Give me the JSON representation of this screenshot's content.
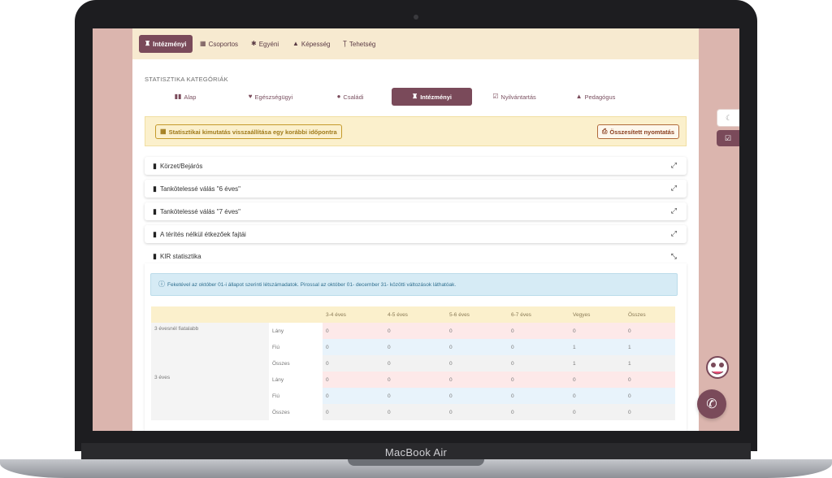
{
  "device": {
    "brand": "MacBook Air"
  },
  "topnav": {
    "tabs": [
      {
        "label": "Intézményi",
        "icon": "institution-icon",
        "active": true
      },
      {
        "label": "Csoportos",
        "icon": "grid-icon"
      },
      {
        "label": "Egyéni",
        "icon": "gear-icon"
      },
      {
        "label": "Képesség",
        "icon": "graduation-cap-icon"
      },
      {
        "label": "Tehetség",
        "icon": "trophy-icon"
      }
    ]
  },
  "section_title": "STATISZTIKA KATEGÓRIÁK",
  "categories": [
    {
      "label": "Alap",
      "icon": "columns-icon"
    },
    {
      "label": "Egészségügyi",
      "icon": "heart-icon"
    },
    {
      "label": "Családi",
      "icon": "user-icon"
    },
    {
      "label": "Intézményi",
      "icon": "institution-icon",
      "active": true
    },
    {
      "label": "Nyilvántartás",
      "icon": "check-square-icon"
    },
    {
      "label": "Pedagógus",
      "icon": "graduation-cap-icon"
    }
  ],
  "alert": {
    "restore_label": "Statisztikai kimutatás visszaállítása egy korábbi időpontra",
    "print_label": "Összesített nyomtatás"
  },
  "accordions": [
    {
      "label": "Körzet/Bejárós"
    },
    {
      "label": "Tankötelessé válás \"6 éves\""
    },
    {
      "label": "Tankötelessé válás \"7 éves\""
    },
    {
      "label": "A térítés nélkül étkezőek fajtái"
    },
    {
      "label": "KIR statisztika"
    }
  ],
  "kir": {
    "info": "Feketével az október 01-i állapot szerinti létszámadatok. Pirossal az október 01- december 31- közötti változások láthatóak.",
    "headers": [
      "3-4 éves",
      "4-5 éves",
      "5-6 éves",
      "6-7 éves",
      "Vegyes",
      "Összes"
    ],
    "groups": [
      {
        "label": "3 évesnél fiatalabb",
        "rows": [
          {
            "label": "Lány",
            "values": [
              "0",
              "0",
              "0",
              "0",
              "0",
              "0"
            ]
          },
          {
            "label": "Fiú",
            "values": [
              "0",
              "0",
              "0",
              "0",
              "1",
              "1"
            ]
          },
          {
            "label": "Összes",
            "values": [
              "0",
              "0",
              "0",
              "0",
              "1",
              "1"
            ]
          }
        ]
      },
      {
        "label": "3 éves",
        "rows": [
          {
            "label": "Lány",
            "values": [
              "0",
              "0",
              "0",
              "0",
              "0",
              "0"
            ]
          },
          {
            "label": "Fiú",
            "values": [
              "0",
              "0",
              "0",
              "0",
              "0",
              "0"
            ]
          },
          {
            "label": "Összes",
            "values": [
              "0",
              "0",
              "0",
              "0",
              "0",
              "0"
            ]
          }
        ]
      }
    ]
  },
  "colors": {
    "accent": "#7a4a5a",
    "nav_bg": "#f7ead0",
    "screen_bg": "#dbb5ae"
  }
}
